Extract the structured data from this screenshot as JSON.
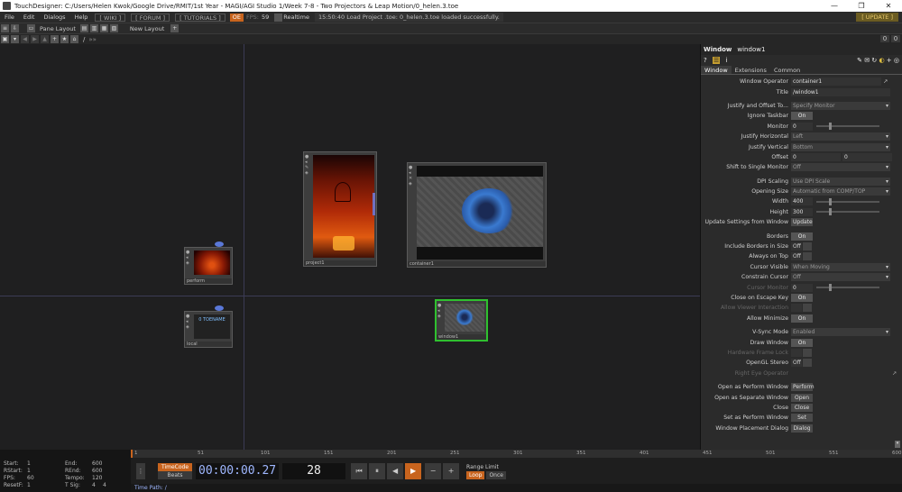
{
  "window_title": "TouchDesigner: C:/Users/Helen Kwok/Google Drive/RMIT/1st Year - MAGI/AGI Studio 1/Week 7-8 - Two Projectors & Leap Motion/0_helen.3.toe",
  "window_controls": [
    "—",
    "❐",
    "✕"
  ],
  "menu": {
    "items": [
      "File",
      "Edit",
      "Dialogs",
      "Help"
    ],
    "links": [
      "[ WIKI ]",
      "[ FORUM ]",
      "[ TUTORIALS ]"
    ],
    "oc": "OE",
    "fps_label": "FPS:",
    "fps_value": "59",
    "realtime": "Realtime",
    "message": "15:50:40 Load Project .toe: 0_helen.3.toe loaded successfully.",
    "update": "[ UPDATE ]"
  },
  "toolbar": {
    "pane_layout": "Pane Layout",
    "new_layout": "New Layout",
    "plus": "+",
    "path": "/",
    "path_extra": "»»",
    "right_a": "0",
    "right_b": "0"
  },
  "nodes": [
    {
      "name": "project1"
    },
    {
      "name": "container1"
    },
    {
      "name": "perform"
    },
    {
      "name": "local",
      "text": "0 TOENAME"
    },
    {
      "name": "window1"
    }
  ],
  "panel": {
    "type": "Window",
    "name": "window1",
    "tabs": [
      "Window",
      "Extensions",
      "Common"
    ],
    "rows": [
      {
        "label": "Window Operator",
        "value": "container1",
        "kind": "field"
      },
      {
        "label": "Title",
        "value": "/window1",
        "kind": "field"
      },
      {
        "sep": true
      },
      {
        "label": "Justify and Offset To...",
        "value": "Specify Monitor",
        "kind": "menu"
      },
      {
        "label": "Ignore Taskbar",
        "value": "On",
        "kind": "tog"
      },
      {
        "label": "Monitor",
        "value": "0",
        "kind": "field"
      },
      {
        "label": "Justify Horizontal",
        "value": "Left",
        "kind": "menu"
      },
      {
        "label": "Justify Vertical",
        "value": "Bottom",
        "kind": "menu"
      },
      {
        "label": "Offset",
        "value": "0",
        "value2": "0",
        "kind": "field2"
      },
      {
        "label": "Shift to Single Monitor",
        "value": "Off",
        "kind": "menu"
      },
      {
        "sep": true
      },
      {
        "label": "DPI Scaling",
        "value": "Use DPI Scale",
        "kind": "menu"
      },
      {
        "label": "Opening Size",
        "value": "Automatic from COMP/TOP",
        "kind": "menu"
      },
      {
        "label": "Width",
        "value": "400",
        "kind": "field"
      },
      {
        "label": "Height",
        "value": "300",
        "kind": "field"
      },
      {
        "label": "Update Settings from Window",
        "value": "Update",
        "kind": "btn"
      },
      {
        "sep": true
      },
      {
        "label": "Borders",
        "value": "On",
        "kind": "tog"
      },
      {
        "label": "Include Borders in Size",
        "value": "Off",
        "kind": "off"
      },
      {
        "label": "Always on Top",
        "value": "Off",
        "kind": "off"
      },
      {
        "label": "Cursor Visible",
        "value": "When Moving",
        "kind": "menu"
      },
      {
        "label": "Constrain Cursor",
        "value": "Off",
        "kind": "menu"
      },
      {
        "label": "Cursor Monitor",
        "value": "0",
        "kind": "field",
        "dim": true
      },
      {
        "label": "Close on Escape Key",
        "value": "On",
        "kind": "tog"
      },
      {
        "label": "Allow Viewer Interaction",
        "value": "",
        "kind": "off",
        "dim": true
      },
      {
        "label": "Allow Minimize",
        "value": "On",
        "kind": "tog"
      },
      {
        "sep": true
      },
      {
        "label": "V-Sync Mode",
        "value": "Enabled",
        "kind": "menu"
      },
      {
        "label": "Draw Window",
        "value": "On",
        "kind": "tog"
      },
      {
        "label": "Hardware Frame Lock",
        "value": "",
        "kind": "off",
        "dim": true
      },
      {
        "label": "OpenGL Stereo",
        "value": "Off",
        "kind": "off"
      },
      {
        "label": "Right Eye Operator",
        "value": "",
        "kind": "none",
        "dim": true
      },
      {
        "sep": true
      },
      {
        "label": "Open as Perform Window",
        "value": "Perform",
        "kind": "btn"
      },
      {
        "label": "Open as Separate Window",
        "value": "Open",
        "kind": "btn"
      },
      {
        "label": "Close",
        "value": "Close",
        "kind": "btn"
      },
      {
        "label": "Set as Perform Window",
        "value": "Set",
        "kind": "btn"
      },
      {
        "label": "Window Placement Dialog",
        "value": "Dialog",
        "kind": "btn"
      }
    ]
  },
  "stats": {
    "start_label": "Start:",
    "start": "1",
    "end_label": "End:",
    "end": "600",
    "rstart_label": "RStart:",
    "rstart": "1",
    "rend_label": "REnd:",
    "rend": "600",
    "fps_label": "FPS:",
    "fps": "60",
    "tempo_label": "Tempo:",
    "tempo": "120",
    "resetf_label": "ResetF:",
    "resetf": "1",
    "tsig_label": "T Sig:",
    "tsig_a": "4",
    "tsig_b": "4"
  },
  "ruler": [
    "1",
    "51",
    "101",
    "151",
    "201",
    "251",
    "301",
    "351",
    "401",
    "451",
    "501",
    "551",
    "600"
  ],
  "transport": {
    "timecode_btn": "TimeCode",
    "beats_btn": "Beats",
    "timecode": "00:00:00.27",
    "frame": "28",
    "buttons": [
      "⏮",
      "⏸",
      "◀",
      "▶",
      "−",
      "+"
    ],
    "range_limit": "Range Limit",
    "loop": "Loop",
    "once": "Once"
  },
  "time_path": "Time Path: /"
}
